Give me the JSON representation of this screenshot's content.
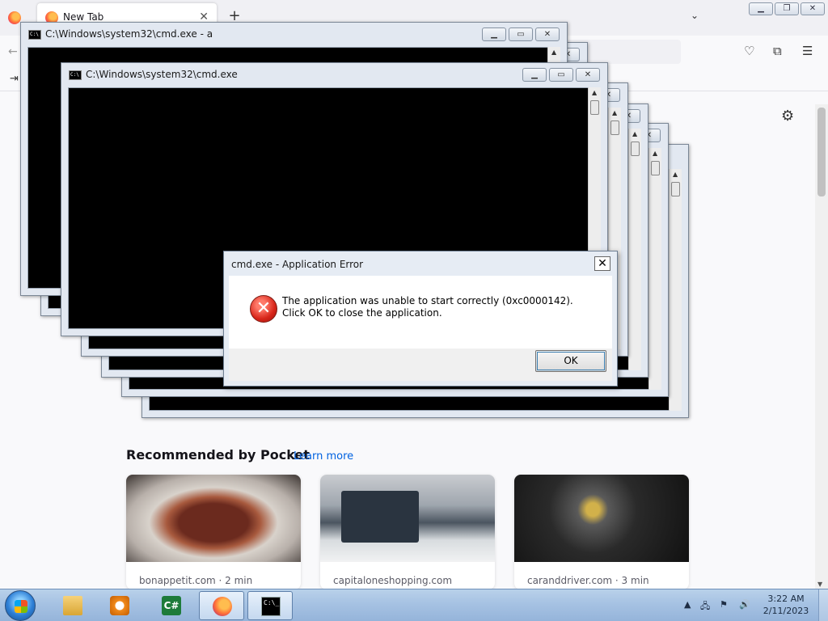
{
  "browser": {
    "tab_title": "New Tab",
    "tab_close": "✕",
    "new_tab": "+",
    "tab_list": "⌄",
    "pocket": {
      "title": "Recommended by Pocket",
      "learn_more": "Learn more",
      "cards": [
        {
          "source": "bonappetit.com · 2 min"
        },
        {
          "source": "capitaloneshopping.com"
        },
        {
          "source": "caranddriver.com · 3 min"
        }
      ]
    }
  },
  "cmd_windows": {
    "front_title": "C:\\Windows\\system32\\cmd.exe",
    "back_title": "C:\\Windows\\system32\\cmd.exe - a",
    "icon_text": "C:\\"
  },
  "dialog": {
    "title": "cmd.exe - Application Error",
    "close": "✕",
    "message": "The application was unable to start correctly (0xc0000142). Click OK to close the application.",
    "ok": "OK",
    "icon_glyph": "✕"
  },
  "taskbar": {
    "csharp_label": "C#",
    "cmd_label": "C:\\_",
    "time": "3:22 AM",
    "date": "2/11/2023"
  },
  "colors": {
    "error_red": "#d8261a",
    "link_blue": "#0061e0",
    "taskbar_blue": "#a6c2e3"
  },
  "icons": [
    "firefox-icon",
    "close-icon",
    "plus-icon",
    "chevron-down-icon",
    "minimize-icon",
    "maximize-icon",
    "restore-icon",
    "back-arrow-icon",
    "pocket-icon",
    "extensions-icon",
    "menu-icon",
    "gear-icon",
    "error-icon",
    "start-orb-icon",
    "explorer-icon",
    "media-player-icon",
    "csharp-icon",
    "cmd-icon",
    "network-icon",
    "flag-icon",
    "speaker-icon"
  ]
}
